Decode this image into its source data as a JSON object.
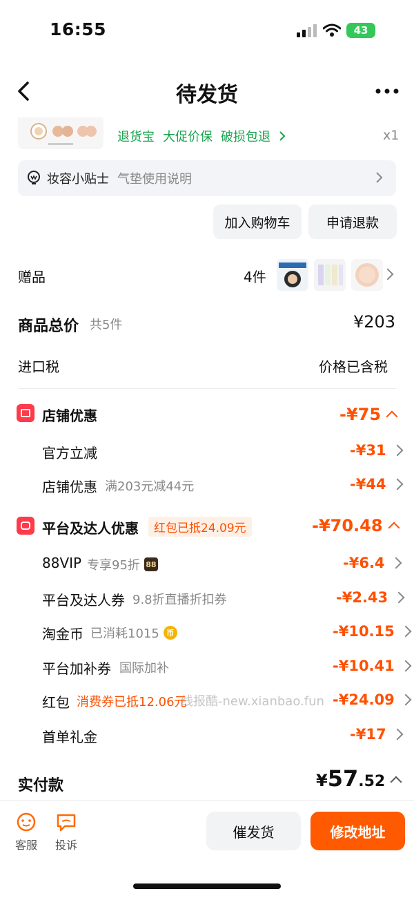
{
  "status": {
    "time": "16:55",
    "battery": "43"
  },
  "nav": {
    "title": "待发货"
  },
  "product": {
    "service_tags": [
      "退货宝",
      "大促价保",
      "破损包退"
    ],
    "quantity": "x1"
  },
  "tip": {
    "title": "妆容小贴士",
    "subtitle": "气垫使用说明"
  },
  "actions": {
    "add_to_cart": "加入购物车",
    "refund": "申请退款"
  },
  "gifts": {
    "label": "赠品",
    "count": "4件"
  },
  "totals": {
    "goods_label": "商品总价",
    "goods_count": "共5件",
    "goods_price": "¥203",
    "tax_label": "进口税",
    "tax_value": "价格已含税"
  },
  "store_discount": {
    "title": "店铺优惠",
    "total": "-¥75",
    "items": [
      {
        "label": "官方立减",
        "sub": "",
        "value": "-¥31"
      },
      {
        "label": "店铺优惠",
        "sub": "满203元减44元",
        "value": "-¥44"
      }
    ]
  },
  "platform_discount": {
    "title": "平台及达人优惠",
    "tag": "红包已抵24.09元",
    "total": "-¥70.48",
    "items": [
      {
        "label": "88VIP",
        "sub": "专享95折",
        "chip": "88",
        "value": "-¥6.4"
      },
      {
        "label": "平台及达人券",
        "sub": "9.8折直播折扣券",
        "value": "-¥2.43"
      },
      {
        "label": "淘金币",
        "sub": "已消耗1015",
        "chip": "币",
        "value": "-¥10.15"
      },
      {
        "label": "平台加补券",
        "sub": "国际加补",
        "value": "-¥10.41"
      },
      {
        "label": "红包",
        "sub": "消费券已抵12.06元",
        "value": "-¥24.09"
      },
      {
        "label": "首单礼金",
        "sub": "",
        "value": "-¥17"
      }
    ]
  },
  "watermark": "线报酷-new.xianbao.fun",
  "paid": {
    "label": "实付款",
    "currency": "¥",
    "integer": "57",
    "decimal": ".52"
  },
  "bottom": {
    "service_label": "客服",
    "complaint_label": "投诉",
    "urge_label": "催发货",
    "change_address_label": "修改地址"
  },
  "colors": {
    "accent": "#ff5000",
    "green": "#16a34a",
    "store_red": "#ff3a4a"
  }
}
